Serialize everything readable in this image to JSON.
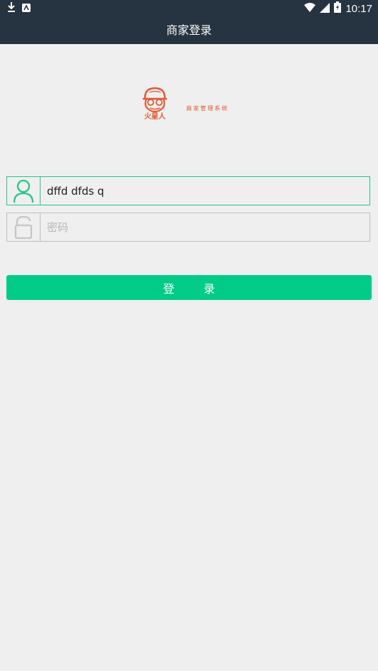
{
  "status_bar": {
    "left_icons": [
      "download-icon",
      "android-notification-icon"
    ],
    "right_icons": [
      "wifi-icon",
      "signal-icon",
      "battery-icon"
    ],
    "time": "10:17"
  },
  "app_bar": {
    "title": "商家登录"
  },
  "logo": {
    "mark_text": "火星人",
    "subtitle": "商家管理系统"
  },
  "form": {
    "username": {
      "value": "dffd dfds q",
      "icon": "user-icon"
    },
    "password": {
      "placeholder": "密码",
      "icon": "lock-icon"
    },
    "submit_label": "登 录"
  },
  "colors": {
    "status_bar": "#263340",
    "background": "#efefef",
    "accent": "#00cc88",
    "brand": "#e4562f"
  }
}
